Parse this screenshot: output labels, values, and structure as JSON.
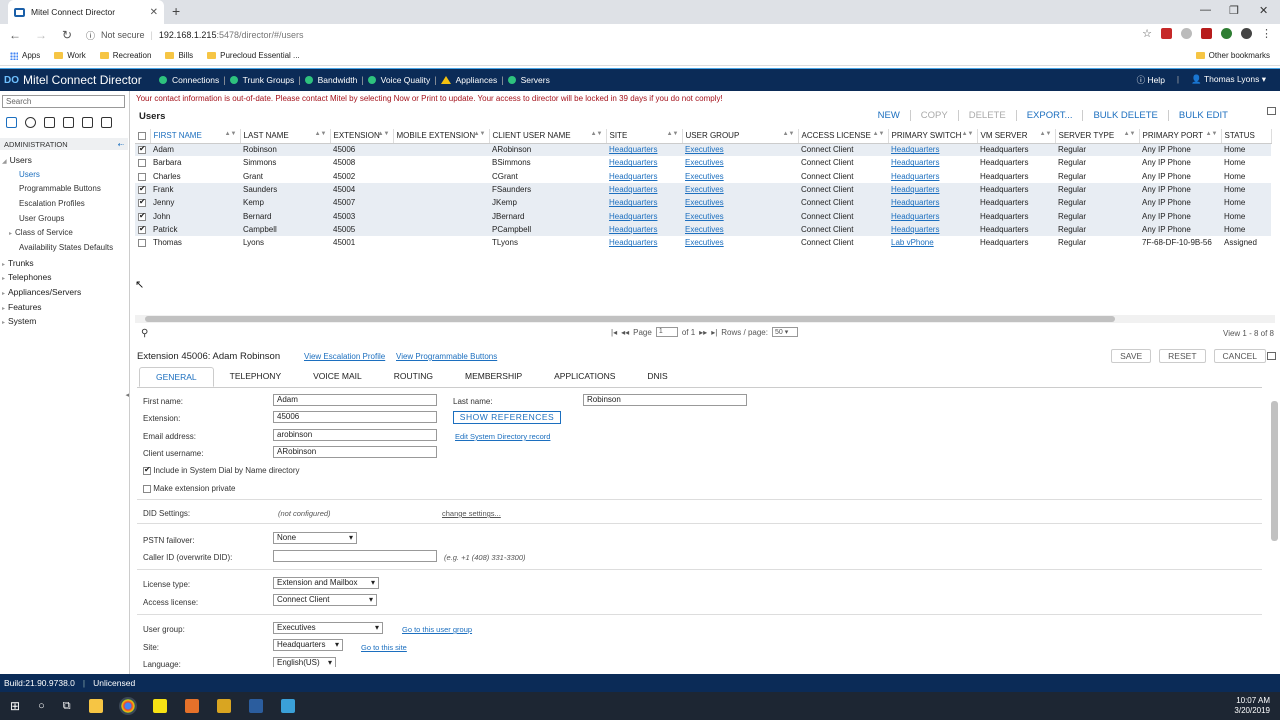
{
  "browser": {
    "tab_title": "Mitel Connect Director",
    "url_security": "Not secure",
    "url_host": "192.168.1.215",
    "url_rest": ":5478/director/#/users",
    "bookmarks": [
      "Apps",
      "Work",
      "Recreation",
      "Bills",
      "Purecloud Essential ..."
    ],
    "other_bookmarks": "Other bookmarks"
  },
  "header": {
    "brand": "Mitel Connect Director",
    "logo": "DO",
    "nav": [
      {
        "label": "Connections",
        "status": "green"
      },
      {
        "label": "Trunk Groups",
        "status": "green"
      },
      {
        "label": "Bandwidth",
        "status": "green"
      },
      {
        "label": "Voice Quality",
        "status": "green"
      },
      {
        "label": "Appliances",
        "status": "warning"
      },
      {
        "label": "Servers",
        "status": "green"
      }
    ],
    "help": "Help",
    "user": "Thomas Lyons ▾"
  },
  "sidebar": {
    "search_placeholder": "Search",
    "section": "ADMINISTRATION",
    "items": {
      "users": "Users",
      "users_sub": "Users",
      "prog_buttons": "Programmable Buttons",
      "escalation": "Escalation Profiles",
      "user_groups": "User Groups",
      "class_of_service": "Class of Service",
      "availability": "Availability States Defaults",
      "trunks": "Trunks",
      "telephones": "Telephones",
      "appliances": "Appliances/Servers",
      "features": "Features",
      "system": "System"
    }
  },
  "notice": "Your contact information is out-of-date. Please contact Mitel by selecting Now or Print to update. Your access to director will be locked in 39 days if you do not comply!",
  "users": {
    "title": "Users",
    "actions": [
      {
        "label": "NEW",
        "enabled": true
      },
      {
        "label": "COPY",
        "enabled": false
      },
      {
        "label": "DELETE",
        "enabled": false
      },
      {
        "label": "EXPORT...",
        "enabled": true
      },
      {
        "label": "BULK DELETE",
        "enabled": true
      },
      {
        "label": "BULK EDIT",
        "enabled": true
      }
    ],
    "columns": [
      "FIRST NAME",
      "LAST NAME",
      "EXTENSION",
      "MOBILE EXTENSION",
      "CLIENT USER NAME",
      "SITE",
      "USER GROUP",
      "ACCESS LICENSE",
      "PRIMARY SWITCH",
      "VM SERVER",
      "SERVER TYPE",
      "PRIMARY PORT",
      "STATUS"
    ],
    "rows": [
      {
        "checked": true,
        "first": "Adam",
        "last": "Robinson",
        "ext": "45006",
        "mobile": "",
        "client": "ARobinson",
        "site": "Headquarters",
        "group": "Executives",
        "license": "Connect Client",
        "switch": "Headquarters",
        "vm": "Headquarters",
        "type": "Regular",
        "port": "Any IP Phone",
        "status": "Home"
      },
      {
        "checked": false,
        "first": "Barbara",
        "last": "Simmons",
        "ext": "45008",
        "mobile": "",
        "client": "BSimmons",
        "site": "Headquarters",
        "group": "Executives",
        "license": "Connect Client",
        "switch": "Headquarters",
        "vm": "Headquarters",
        "type": "Regular",
        "port": "Any IP Phone",
        "status": "Home"
      },
      {
        "checked": false,
        "first": "Charles",
        "last": "Grant",
        "ext": "45002",
        "mobile": "",
        "client": "CGrant",
        "site": "Headquarters",
        "group": "Executives",
        "license": "Connect Client",
        "switch": "Headquarters",
        "vm": "Headquarters",
        "type": "Regular",
        "port": "Any IP Phone",
        "status": "Home"
      },
      {
        "checked": true,
        "first": "Frank",
        "last": "Saunders",
        "ext": "45004",
        "mobile": "",
        "client": "FSaunders",
        "site": "Headquarters",
        "group": "Executives",
        "license": "Connect Client",
        "switch": "Headquarters",
        "vm": "Headquarters",
        "type": "Regular",
        "port": "Any IP Phone",
        "status": "Home"
      },
      {
        "checked": true,
        "first": "Jenny",
        "last": "Kemp",
        "ext": "45007",
        "mobile": "",
        "client": "JKemp",
        "site": "Headquarters",
        "group": "Executives",
        "license": "Connect Client",
        "switch": "Headquarters",
        "vm": "Headquarters",
        "type": "Regular",
        "port": "Any IP Phone",
        "status": "Home"
      },
      {
        "checked": true,
        "first": "John",
        "last": "Bernard",
        "ext": "45003",
        "mobile": "",
        "client": "JBernard",
        "site": "Headquarters",
        "group": "Executives",
        "license": "Connect Client",
        "switch": "Headquarters",
        "vm": "Headquarters",
        "type": "Regular",
        "port": "Any IP Phone",
        "status": "Home"
      },
      {
        "checked": true,
        "first": "Patrick",
        "last": "Campbell",
        "ext": "45005",
        "mobile": "",
        "client": "PCampbell",
        "site": "Headquarters",
        "group": "Executives",
        "license": "Connect Client",
        "switch": "Headquarters",
        "vm": "Headquarters",
        "type": "Regular",
        "port": "Any IP Phone",
        "status": "Home"
      },
      {
        "checked": false,
        "first": "Thomas",
        "last": "Lyons",
        "ext": "45001",
        "mobile": "",
        "client": "TLyons",
        "site": "Headquarters",
        "group": "Executives",
        "license": "Connect Client",
        "switch": "Lab vPhone",
        "vm": "Headquarters",
        "type": "Regular",
        "port": "7F-68-DF-10-9B-56",
        "status": "Assigned"
      }
    ],
    "pager": {
      "page_label": "Page",
      "page": "1",
      "of": "of 1",
      "rows_label": "Rows / page:",
      "rows": "50",
      "view": "View 1 - 8 of 8"
    }
  },
  "detail": {
    "title": "Extension 45006: Adam Robinson",
    "link_escalation": "View Escalation Profile",
    "link_prog": "View Programmable Buttons",
    "save": "SAVE",
    "reset": "RESET",
    "cancel": "CANCEL",
    "tabs": [
      "GENERAL",
      "TELEPHONY",
      "VOICE MAIL",
      "ROUTING",
      "MEMBERSHIP",
      "APPLICATIONS",
      "DNIS"
    ],
    "form": {
      "first_name_label": "First name:",
      "first_name": "Adam",
      "last_name_label": "Last name:",
      "last_name": "Robinson",
      "extension_label": "Extension:",
      "extension": "45006",
      "show_refs": "SHOW REFERENCES",
      "email_label": "Email address:",
      "email": "arobinson",
      "edit_dir": "Edit System Directory record",
      "client_label": "Client username:",
      "client": "ARobinson",
      "dial_by_name": "Include in System Dial by Name directory",
      "private": "Make extension private",
      "did_label": "DID Settings:",
      "did_value": "(not configured)",
      "did_change": "change settings...",
      "pstn_label": "PSTN failover:",
      "pstn": "None",
      "callerid_label": "Caller ID (overwrite DID):",
      "callerid_hint": "(e.g. +1 (408) 331-3300)",
      "license_type_label": "License type:",
      "license_type": "Extension and Mailbox",
      "access_label": "Access license:",
      "access": "Connect Client",
      "group_label": "User group:",
      "group": "Executives",
      "group_link": "Go to this user group",
      "site_label": "Site:",
      "site": "Headquarters",
      "site_link": "Go to this site",
      "language_label": "Language:",
      "language": "English(US)"
    }
  },
  "status": {
    "build": "Build:21.90.9738.0",
    "license": "Unlicensed"
  },
  "taskbar": {
    "time": "10:07 AM",
    "date": "3/20/2019"
  }
}
